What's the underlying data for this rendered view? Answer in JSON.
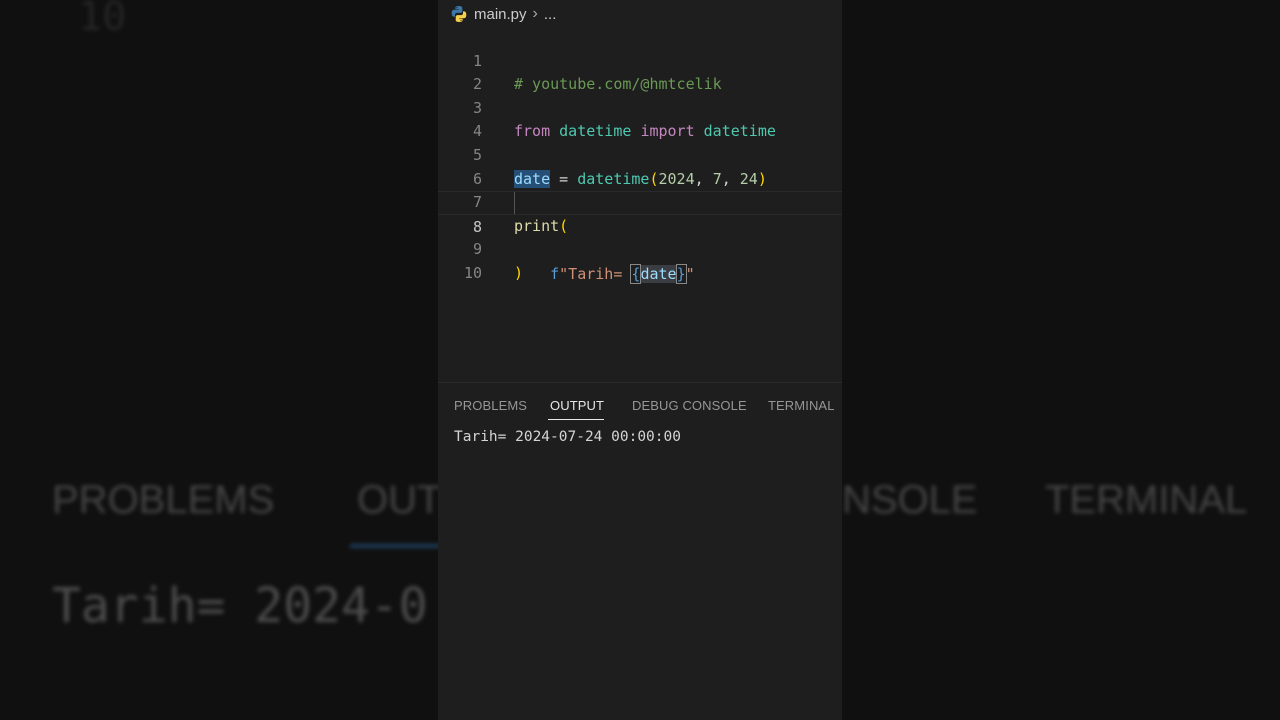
{
  "background": {
    "line_number": "10",
    "tabs": [
      "PROBLEMS",
      "OUT",
      "NSOLE",
      "TERMINAL"
    ],
    "output_text": "Tarih= 2024-0"
  },
  "editor": {
    "breadcrumb": {
      "file": "main.py",
      "separator": "›",
      "more": "..."
    },
    "lines": [
      {
        "n": "1",
        "text": "# youtube.com/@hmtcelik"
      },
      {
        "n": "2",
        "text": ""
      },
      {
        "n": "3",
        "text": "from datetime import datetime"
      },
      {
        "n": "4",
        "text": ""
      },
      {
        "n": "5",
        "text": "date = datetime(2024, 7, 24)"
      },
      {
        "n": "6",
        "text": ""
      },
      {
        "n": "7",
        "text": "print("
      },
      {
        "n": "8",
        "text": "    f\"Tarih= {date}\""
      },
      {
        "n": "9",
        "text": ")"
      },
      {
        "n": "10",
        "text": ""
      }
    ],
    "current_line": "8"
  },
  "panel": {
    "tabs": [
      "PROBLEMS",
      "OUTPUT",
      "DEBUG CONSOLE",
      "TERMINAL"
    ],
    "active_tab": "OUTPUT",
    "output": "Tarih= 2024-07-24 00:00:00"
  },
  "colors": {
    "editor_bg": "#1e1e1e",
    "keyword": "#c586c0",
    "class": "#4ec9b0",
    "string": "#ce9178",
    "comment": "#6a9955"
  }
}
